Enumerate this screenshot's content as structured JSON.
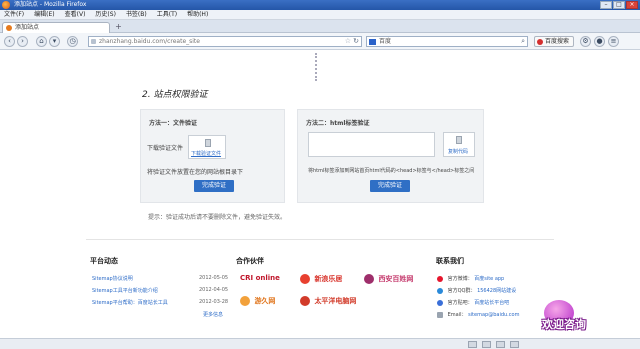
{
  "window": {
    "title": "添加站点 - Mozilla Firefox"
  },
  "menu": [
    "文件(F)",
    "编辑(E)",
    "查看(V)",
    "历史(S)",
    "书签(B)",
    "工具(T)",
    "帮助(H)"
  ],
  "tab": {
    "label": "添加站点"
  },
  "nav": {
    "url": "zhanzhang.baidu.com/create_site",
    "search_placeholder": "百度",
    "tool_label": "百度搜索"
  },
  "page": {
    "section_title": "2. 站点权限验证",
    "file_method": {
      "title": "方法一：文件验证",
      "download_label": "下载验证文件",
      "file_text": "下载验证文件",
      "instruction": "将验证文件放置在您的网站根目录下",
      "verify_button": "完成验证"
    },
    "html_method": {
      "title": "方法二：html标签验证",
      "copy_text": "复制代码",
      "instruction": "将html标签添加到网站首页html代码的<head>标签与</head>标签之间",
      "verify_button": "完成验证"
    },
    "hint": "提示：验证成功后请不要删除文件，避免验证失效。"
  },
  "footer": {
    "news_title": "平台动态",
    "news": [
      {
        "title": "Sitemap协议说明",
        "date": "2012-05-05"
      },
      {
        "title": "Sitemap工具平台新功能介绍",
        "date": "2012-04-05"
      },
      {
        "title": "Sitemap平台帮助：百度站长工具",
        "date": "2012-03-28"
      }
    ],
    "more": "更多信息",
    "partners_title": "合作伙伴",
    "partners": [
      "CRI online",
      "新浪乐居",
      "西安百姓网",
      "游久网",
      "太平洋电脑网"
    ],
    "contact_title": "联系我们",
    "contacts": [
      {
        "label": "官方微博：",
        "value": "百度site app"
      },
      {
        "label": "官方QQ群：",
        "value": "156428网站建设"
      },
      {
        "label": "官方贴吧：",
        "value": "百度站长平台吧"
      },
      {
        "label": "Email：",
        "value": "sitemap@baidu.com"
      }
    ]
  },
  "widget": {
    "chat_text": "欢迎咨询"
  },
  "colors": {
    "accent": "#2f6fc5",
    "link": "#2c6bc7",
    "panel_bg": "#f1f3f5",
    "titlebar": "#2456a8"
  }
}
